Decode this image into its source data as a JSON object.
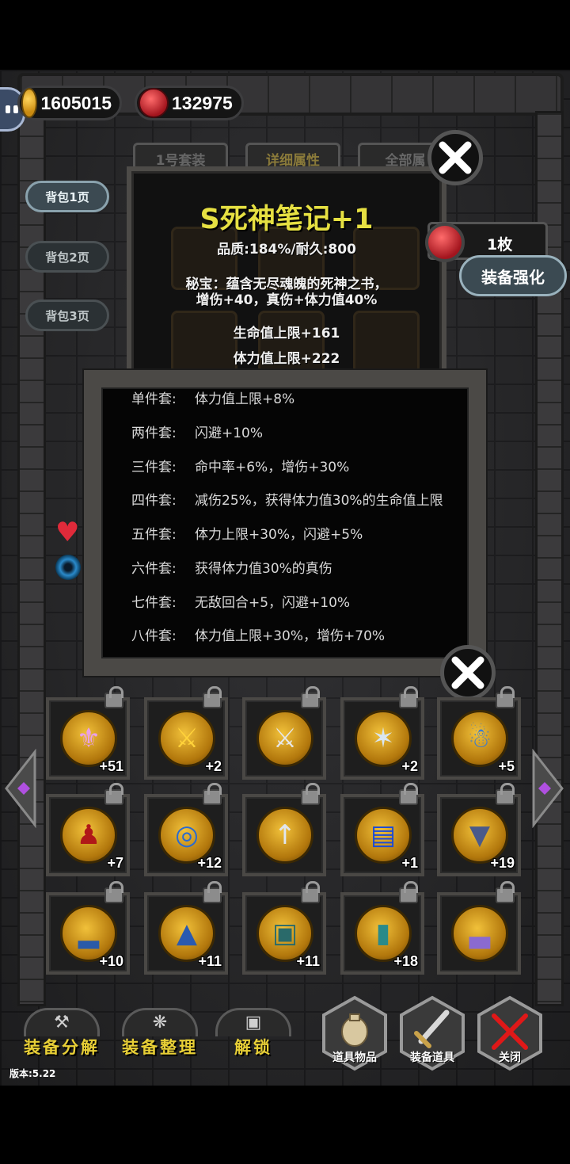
{
  "currency": {
    "gold": "1605015",
    "gems": "132975"
  },
  "bag_pages": [
    "背包1页",
    "背包2页",
    "背包3页"
  ],
  "tabs": [
    "1号套装",
    "详细属性",
    "全部属"
  ],
  "item": {
    "name": "S死神笔记+1",
    "quality": "品质:184%/耐久:800",
    "secret_line1": "秘宝：蕴含无尽魂魄的死神之书，",
    "secret_line2": "增伤+40，真伤+体力值40%",
    "stat1": "生命值上限+161",
    "stat2": "体力值上限+222"
  },
  "strengthen": {
    "count": "1枚",
    "label": "装备强化"
  },
  "set_bonus": [
    {
      "k": "单件套:",
      "v": "体力值上限+8%"
    },
    {
      "k": "两件套:",
      "v": "闪避+10%"
    },
    {
      "k": "三件套:",
      "v": "命中率+6%，增伤+30%"
    },
    {
      "k": "四件套:",
      "v": "减伤25%，获得体力值30%的生命值上限"
    },
    {
      "k": "五件套:",
      "v": "体力上限+30%，闪避+5%"
    },
    {
      "k": "六件套:",
      "v": "获得体力值30%的真伤"
    },
    {
      "k": "七件套:",
      "v": "无敌回合+5，闪避+10%"
    },
    {
      "k": "八件套:",
      "v": "体力值上限+30%，增伤+70%"
    }
  ],
  "inventory": [
    {
      "icon": "winged-crest-icon",
      "plus": "+51"
    },
    {
      "icon": "golden-sword-icon",
      "plus": "+2"
    },
    {
      "icon": "broadsword-icon",
      "plus": ""
    },
    {
      "icon": "feather-blade-icon",
      "plus": "+2"
    },
    {
      "icon": "blue-golem-icon",
      "plus": "+5"
    },
    {
      "icon": "red-hood-icon",
      "plus": "+7"
    },
    {
      "icon": "blue-amulet-icon",
      "plus": "+12"
    },
    {
      "icon": "silver-spear-icon",
      "plus": ""
    },
    {
      "icon": "blue-tome-icon",
      "plus": "+1"
    },
    {
      "icon": "bat-helmet-icon",
      "plus": "+19"
    },
    {
      "icon": "blue-boots-icon",
      "plus": "+10"
    },
    {
      "icon": "blue-cloak-icon",
      "plus": "+11"
    },
    {
      "icon": "teal-armor-icon",
      "plus": "+11"
    },
    {
      "icon": "teal-shield-icon",
      "plus": "+18"
    },
    {
      "icon": "purple-boots-icon",
      "plus": ""
    }
  ],
  "bottom": {
    "decompose": "装备分解",
    "organize": "装备整理",
    "unlock": "解锁",
    "items": "道具物品",
    "equip_items": "装备道具",
    "close": "关闭"
  },
  "version": "版本:5.22"
}
